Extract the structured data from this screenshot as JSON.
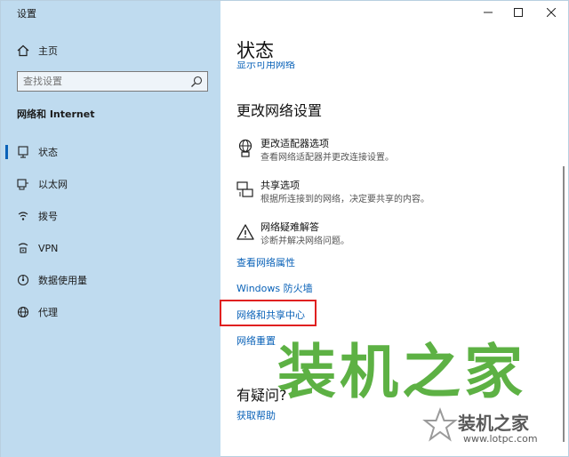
{
  "window": {
    "title": "设置",
    "minimize": "—",
    "maximize": "☐",
    "close": "✕"
  },
  "sidebar": {
    "home_label": "主页",
    "search_placeholder": "查找设置",
    "section_title": "网络和 Internet",
    "items": [
      {
        "label": "状态",
        "icon": "status-icon",
        "active": true
      },
      {
        "label": "以太网",
        "icon": "ethernet-icon"
      },
      {
        "label": "拨号",
        "icon": "dialup-icon"
      },
      {
        "label": "VPN",
        "icon": "vpn-icon"
      },
      {
        "label": "数据使用量",
        "icon": "data-usage-icon"
      },
      {
        "label": "代理",
        "icon": "proxy-icon"
      }
    ]
  },
  "main": {
    "title": "状态",
    "cut_off_link": "显示可用网络",
    "change_settings_heading": "更改网络设置",
    "options": [
      {
        "title": "更改适配器选项",
        "desc": "查看网络适配器并更改连接设置。",
        "icon": "adapter-icon"
      },
      {
        "title": "共享选项",
        "desc": "根据所连接到的网络，决定要共享的内容。",
        "icon": "sharing-icon"
      },
      {
        "title": "网络疑难解答",
        "desc": "诊断并解决网络问题。",
        "icon": "warning-icon"
      }
    ],
    "links": {
      "properties": "查看网络属性",
      "firewall": "Windows 防火墙",
      "sharing_center": "网络和共享中心",
      "reset": "网络重置"
    },
    "question_heading": "有疑问?",
    "help_link": "获取帮助"
  },
  "watermark": {
    "big_text": "装机之家",
    "small_text": "装机之家",
    "url": "www.lotpc.com"
  },
  "colors": {
    "sidebar_bg": "#bfdbef",
    "link": "#0a62b8",
    "highlight_border": "#e02020",
    "watermark_green": "#55ad3b"
  }
}
